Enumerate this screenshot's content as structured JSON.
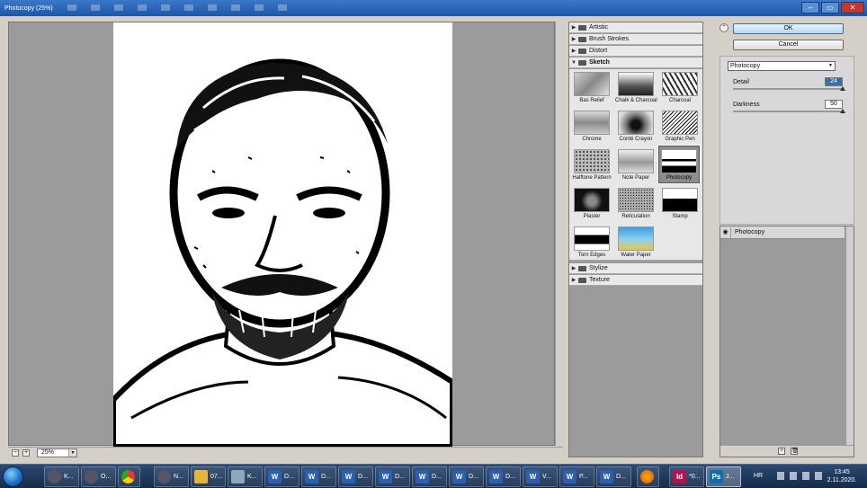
{
  "window": {
    "title": "Photocopy (25%)",
    "controls": [
      "–",
      "▭",
      "✕"
    ]
  },
  "buttons": {
    "ok": "OK",
    "cancel": "Cancel"
  },
  "zoom": {
    "value": "25%",
    "minus": "−",
    "plus": "+"
  },
  "categories": {
    "top": [
      {
        "label": "Artistic",
        "icon": "expand-triangle-icon"
      },
      {
        "label": "Brush Strokes",
        "icon": "expand-triangle-icon"
      },
      {
        "label": "Distort",
        "icon": "expand-triangle-icon"
      },
      {
        "label": "Sketch",
        "icon": "collapse-triangle-icon"
      }
    ],
    "bottom": [
      {
        "label": "Stylize",
        "icon": "expand-triangle-icon"
      },
      {
        "label": "Texture",
        "icon": "expand-triangle-icon"
      }
    ]
  },
  "sketch_filters": [
    {
      "label": "Bas Relief"
    },
    {
      "label": "Chalk & Charcoal"
    },
    {
      "label": "Charcoal"
    },
    {
      "label": "Chrome"
    },
    {
      "label": "Conté Crayon"
    },
    {
      "label": "Graphic Pen"
    },
    {
      "label": "Halftone Pattern"
    },
    {
      "label": "Note Paper"
    },
    {
      "label": "Photocopy"
    },
    {
      "label": "Plaster"
    },
    {
      "label": "Reticulation"
    },
    {
      "label": "Stamp"
    },
    {
      "label": "Torn Edges"
    },
    {
      "label": "Water Paper"
    }
  ],
  "selected_filter": "Photocopy",
  "settings": {
    "filter_dropdown": "Photocopy",
    "detail": {
      "label": "Detail",
      "value": "24",
      "max": 24
    },
    "darkness": {
      "label": "Darkness",
      "value": "50",
      "max": 50
    }
  },
  "layers": {
    "items": [
      {
        "label": "Photocopy"
      }
    ]
  },
  "taskbar": {
    "items": [
      {
        "label": "K...",
        "icon": "app-icon"
      },
      {
        "label": "O...",
        "icon": "app-icon"
      },
      {
        "label": "",
        "icon": "chrome-icon"
      },
      {
        "label": "N...",
        "icon": "app-icon"
      },
      {
        "label": "07...",
        "icon": "folder-icon"
      },
      {
        "label": "K...",
        "icon": "app-icon"
      },
      {
        "label": "D...",
        "icon": "word-icon"
      },
      {
        "label": "D...",
        "icon": "word-icon"
      },
      {
        "label": "D...",
        "icon": "word-icon"
      },
      {
        "label": "D...",
        "icon": "word-icon"
      },
      {
        "label": "D...",
        "icon": "word-icon"
      },
      {
        "label": "D...",
        "icon": "word-icon"
      },
      {
        "label": "D...",
        "icon": "word-icon"
      },
      {
        "label": "V...",
        "icon": "word-icon"
      },
      {
        "label": "P...",
        "icon": "word-icon"
      },
      {
        "label": "D...",
        "icon": "word-icon"
      },
      {
        "label": "",
        "icon": "firefox-icon"
      },
      {
        "label": "*0...",
        "icon": "indesign-icon"
      },
      {
        "label": "J...",
        "icon": "photoshop-icon"
      }
    ],
    "language": "HR",
    "time": "13:45",
    "date": "2.11.2020."
  },
  "colors": {
    "title_bar": "#1e56a8",
    "panel_gray": "#9b9b9b",
    "word_blue": "#2b5fb3",
    "photoshop_blue": "#0b6fb5",
    "indesign_magenta": "#b5104f"
  }
}
